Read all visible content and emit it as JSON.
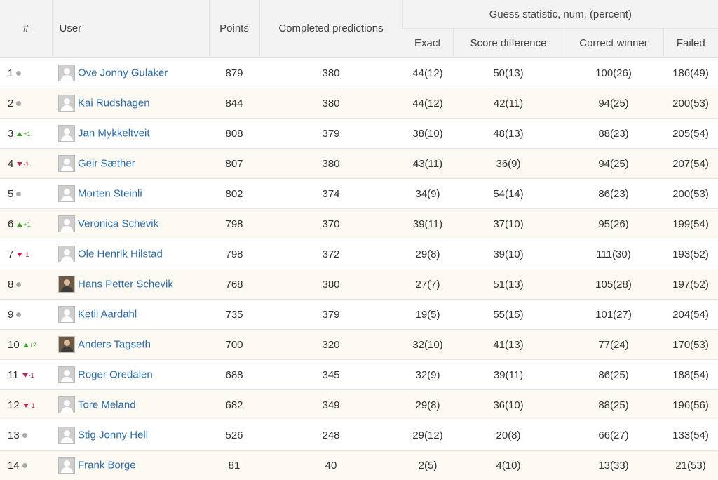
{
  "headers": {
    "rank": "#",
    "user": "User",
    "points": "Points",
    "completed": "Completed predictions",
    "guess_group": "Guess statistic, num. (percent)",
    "exact": "Exact",
    "score_diff": "Score difference",
    "correct_winner": "Correct winner",
    "failed": "Failed"
  },
  "rows": [
    {
      "rank": "1",
      "change": "same",
      "delta": "",
      "user": "Ove Jonny Gulaker",
      "avatar": "placeholder",
      "points": "879",
      "completed": "380",
      "exact": "44(12)",
      "score_diff": "50(13)",
      "correct_winner": "100(26)",
      "failed": "186(49)"
    },
    {
      "rank": "2",
      "change": "same",
      "delta": "",
      "user": "Kai Rudshagen",
      "avatar": "placeholder",
      "points": "844",
      "completed": "380",
      "exact": "44(12)",
      "score_diff": "42(11)",
      "correct_winner": "94(25)",
      "failed": "200(53)"
    },
    {
      "rank": "3",
      "change": "up",
      "delta": "+1",
      "user": "Jan Mykkeltveit",
      "avatar": "placeholder",
      "points": "808",
      "completed": "379",
      "exact": "38(10)",
      "score_diff": "48(13)",
      "correct_winner": "88(23)",
      "failed": "205(54)"
    },
    {
      "rank": "4",
      "change": "down",
      "delta": "-1",
      "user": "Geir Sæther",
      "avatar": "placeholder",
      "points": "807",
      "completed": "380",
      "exact": "43(11)",
      "score_diff": "36(9)",
      "correct_winner": "94(25)",
      "failed": "207(54)"
    },
    {
      "rank": "5",
      "change": "same",
      "delta": "",
      "user": "Morten Steinli",
      "avatar": "placeholder",
      "points": "802",
      "completed": "374",
      "exact": "34(9)",
      "score_diff": "54(14)",
      "correct_winner": "86(23)",
      "failed": "200(53)"
    },
    {
      "rank": "6",
      "change": "up",
      "delta": "+1",
      "user": "Veronica Schevik",
      "avatar": "placeholder",
      "points": "798",
      "completed": "370",
      "exact": "39(11)",
      "score_diff": "37(10)",
      "correct_winner": "95(26)",
      "failed": "199(54)"
    },
    {
      "rank": "7",
      "change": "down",
      "delta": "-1",
      "user": "Ole Henrik Hilstad",
      "avatar": "placeholder",
      "points": "798",
      "completed": "372",
      "exact": "29(8)",
      "score_diff": "39(10)",
      "correct_winner": "111(30)",
      "failed": "193(52)"
    },
    {
      "rank": "8",
      "change": "same",
      "delta": "",
      "user": "Hans Petter Schevik",
      "avatar": "photo",
      "points": "768",
      "completed": "380",
      "exact": "27(7)",
      "score_diff": "51(13)",
      "correct_winner": "105(28)",
      "failed": "197(52)"
    },
    {
      "rank": "9",
      "change": "same",
      "delta": "",
      "user": "Ketil Aardahl",
      "avatar": "placeholder",
      "points": "735",
      "completed": "379",
      "exact": "19(5)",
      "score_diff": "55(15)",
      "correct_winner": "101(27)",
      "failed": "204(54)"
    },
    {
      "rank": "10",
      "change": "up",
      "delta": "+2",
      "user": "Anders Tagseth",
      "avatar": "photo",
      "points": "700",
      "completed": "320",
      "exact": "32(10)",
      "score_diff": "41(13)",
      "correct_winner": "77(24)",
      "failed": "170(53)"
    },
    {
      "rank": "11",
      "change": "down",
      "delta": "-1",
      "user": "Roger Oredalen",
      "avatar": "placeholder",
      "points": "688",
      "completed": "345",
      "exact": "32(9)",
      "score_diff": "39(11)",
      "correct_winner": "86(25)",
      "failed": "188(54)"
    },
    {
      "rank": "12",
      "change": "down",
      "delta": "-1",
      "user": "Tore Meland",
      "avatar": "placeholder",
      "points": "682",
      "completed": "349",
      "exact": "29(8)",
      "score_diff": "36(10)",
      "correct_winner": "88(25)",
      "failed": "196(56)"
    },
    {
      "rank": "13",
      "change": "same",
      "delta": "",
      "user": "Stig Jonny Hell",
      "avatar": "placeholder",
      "points": "526",
      "completed": "248",
      "exact": "29(12)",
      "score_diff": "20(8)",
      "correct_winner": "66(27)",
      "failed": "133(54)"
    },
    {
      "rank": "14",
      "change": "same",
      "delta": "",
      "user": "Frank Borge",
      "avatar": "placeholder",
      "points": "81",
      "completed": "40",
      "exact": "2(5)",
      "score_diff": "4(10)",
      "correct_winner": "13(33)",
      "failed": "21(53)"
    }
  ],
  "colors": {
    "link": "#2d6ca8",
    "up": "#3aa22a",
    "down": "#c0245c",
    "same": "#a9a9a9",
    "stripe": "#fbf9f1",
    "header_bg": "#f3f3f3"
  }
}
